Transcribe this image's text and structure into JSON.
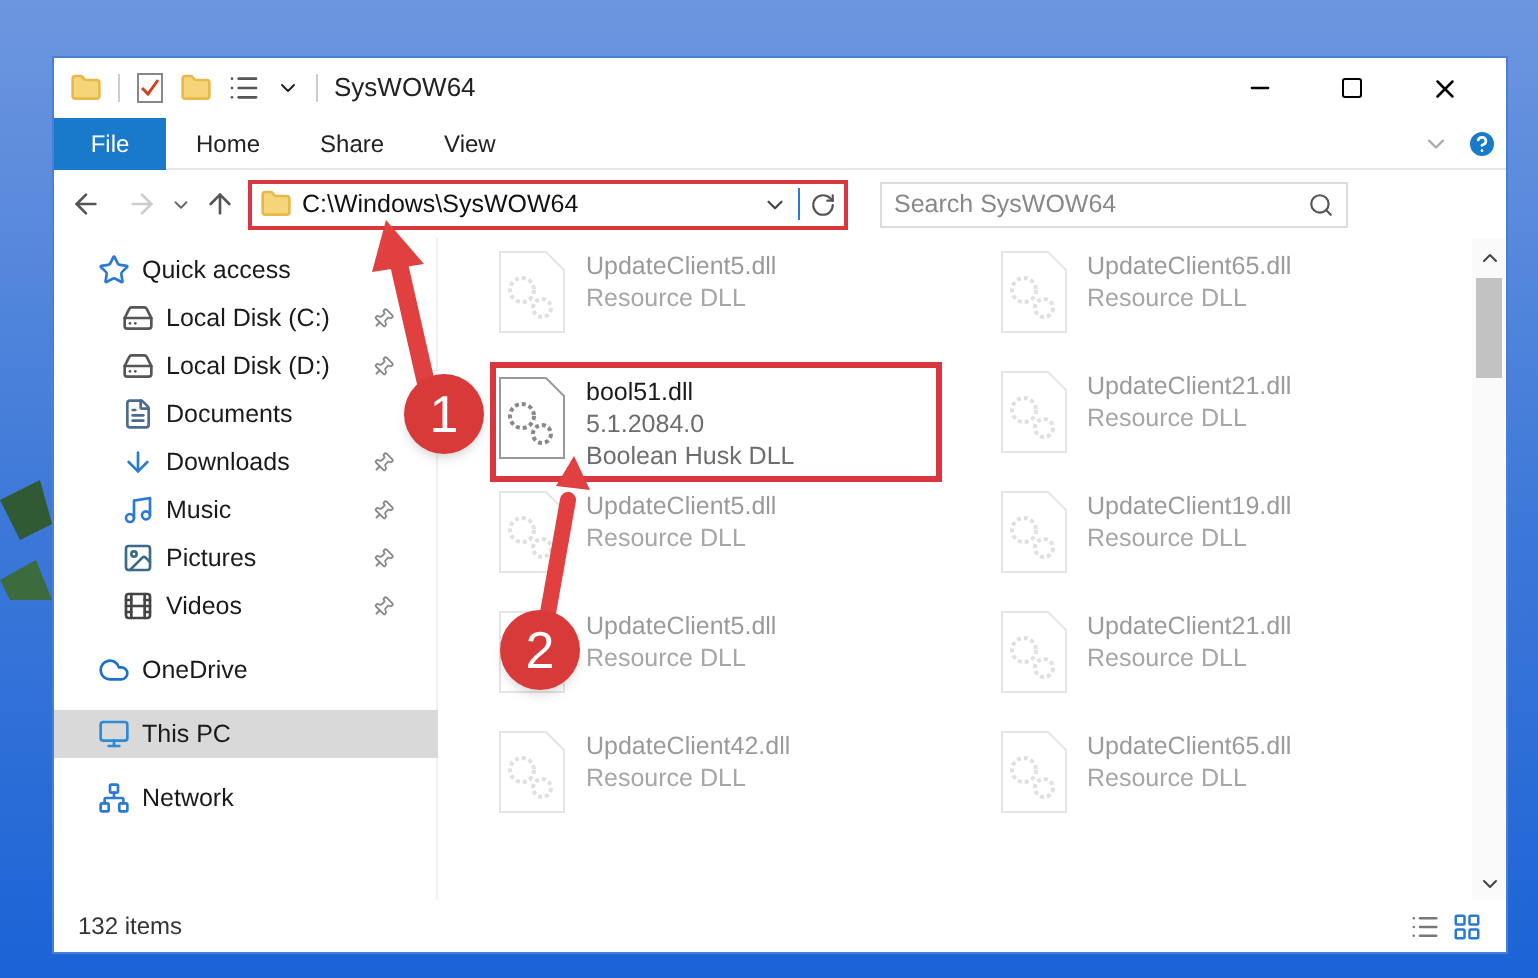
{
  "window": {
    "title": "SysWOW64"
  },
  "ribbon_tabs": [
    {
      "label": "File",
      "kind": "file"
    },
    {
      "label": "Home",
      "kind": "tab"
    },
    {
      "label": "Share",
      "kind": "tab"
    },
    {
      "label": "View",
      "kind": "tab"
    }
  ],
  "address": {
    "path": "C:\\Windows\\SysWOW64"
  },
  "search": {
    "placeholder": "Search SysWOW64"
  },
  "sidebar": {
    "items": [
      {
        "label": "Quick access",
        "selected": false,
        "children": [
          {
            "label": "Local Disk (C:)",
            "selected": false,
            "pinned": true
          },
          {
            "label": "Local Disk (D:)",
            "selected": false,
            "pinned": true
          },
          {
            "label": "Documents",
            "selected": false,
            "pinned": false
          },
          {
            "label": "Downloads",
            "selected": false,
            "pinned": true
          },
          {
            "label": "Music",
            "selected": false,
            "pinned": true
          },
          {
            "label": "Pictures",
            "selected": false,
            "pinned": true
          },
          {
            "label": "Videos",
            "selected": false,
            "pinned": true
          }
        ]
      },
      {
        "label": "OneDrive",
        "selected": false
      },
      {
        "label": "This PC",
        "selected": true
      },
      {
        "label": "Network",
        "selected": false
      }
    ]
  },
  "files": [
    {
      "name": "UpdateClient5.dll",
      "lines": [
        "Resource DLL"
      ],
      "faded": true,
      "outlined": false
    },
    {
      "name": "UpdateClient65.dll",
      "lines": [
        "Resource DLL"
      ],
      "faded": true,
      "outlined": false
    },
    {
      "name": "bool51.dll",
      "lines": [
        "5.1.2084.0",
        "Boolean Husk DLL"
      ],
      "faded": false,
      "outlined": true
    },
    {
      "name": "UpdateClient21.dll",
      "lines": [
        "Resource DLL"
      ],
      "faded": true,
      "outlined": false
    },
    {
      "name": "UpdateClient5.dll",
      "lines": [
        "Resource DLL"
      ],
      "faded": true,
      "outlined": false
    },
    {
      "name": "UpdateClient19.dll",
      "lines": [
        "Resource DLL"
      ],
      "faded": true,
      "outlined": false
    },
    {
      "name": "UpdateClient5.dll",
      "lines": [
        "Resource DLL"
      ],
      "faded": true,
      "outlined": false
    },
    {
      "name": "UpdateClient21.dll",
      "lines": [
        "Resource DLL"
      ],
      "faded": true,
      "outlined": false
    },
    {
      "name": "UpdateClient42.dll",
      "lines": [
        "Resource DLL"
      ],
      "faded": true,
      "outlined": false
    },
    {
      "name": "UpdateClient65.dll",
      "lines": [
        "Resource DLL"
      ],
      "faded": true,
      "outlined": false
    }
  ],
  "status_bar": {
    "count": "132 items"
  },
  "annotations": [
    {
      "number": "1"
    },
    {
      "number": "2"
    }
  ]
}
